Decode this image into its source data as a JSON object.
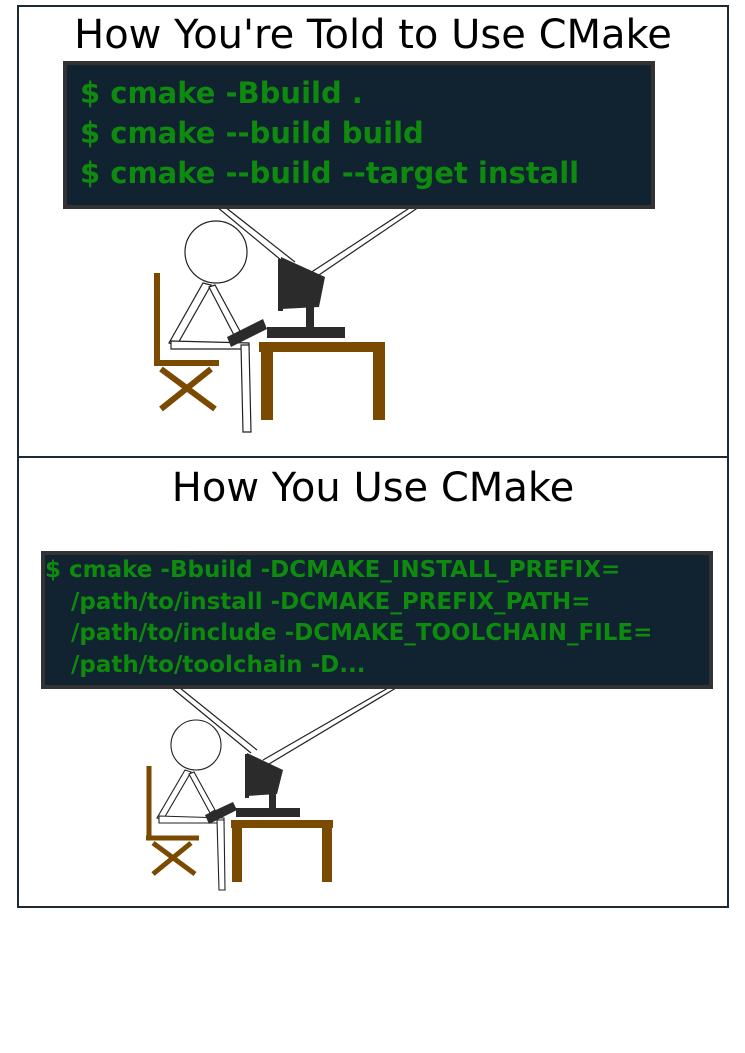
{
  "panels": [
    {
      "title": "How You're Told to Use CMake",
      "terminal_lines": [
        "$ cmake -Bbuild .",
        "$ cmake --build build",
        "$ cmake --build --target install"
      ]
    },
    {
      "title": "How You Use CMake",
      "terminal_lines": [
        "$ cmake -Bbuild -DCMAKE_INSTALL_PREFIX=",
        "/path/to/install -DCMAKE_PREFIX_PATH=",
        "/path/to/include -DCMAKE_TOOLCHAIN_FILE=",
        "/path/to/toolchain -D..."
      ]
    }
  ],
  "colors": {
    "terminal_background": "#112230",
    "terminal_border": "#333333",
    "terminal_text": "#0e8a0e",
    "furniture": "#7a4a00",
    "computer": "#2b2b2b",
    "panel_border": "#1d2a33"
  }
}
